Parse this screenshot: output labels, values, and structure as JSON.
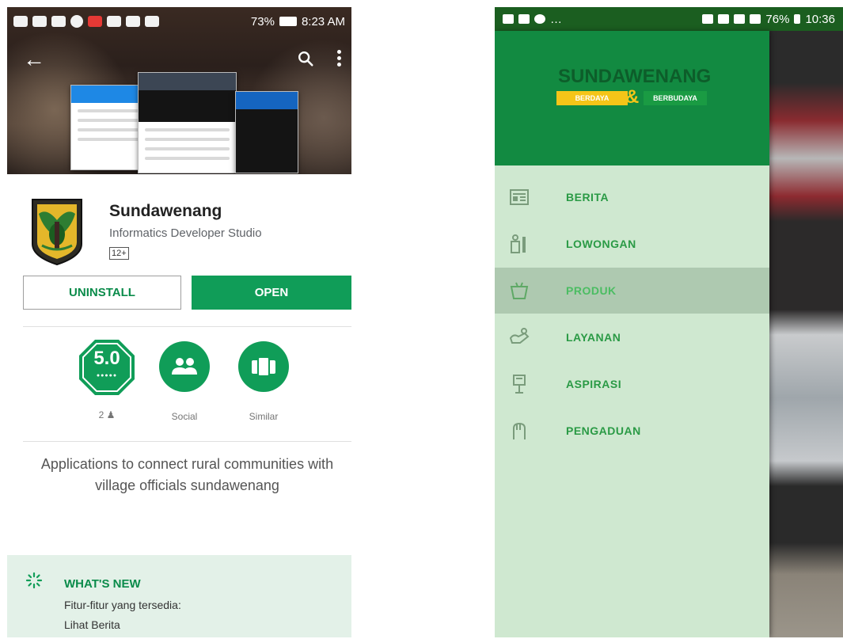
{
  "left": {
    "status_time": "8:23 AM",
    "status_battery": "73%",
    "app": {
      "name": "Sundawenang",
      "developer": "Informatics Developer Studio",
      "content_rating": "12+"
    },
    "buttons": {
      "uninstall": "UNINSTALL",
      "open": "OPEN"
    },
    "badges": {
      "rating_value": "5.0",
      "rating_count": "2",
      "social_label": "Social",
      "similar_label": "Similar"
    },
    "description": "Applications to connect rural communities with village officials sundawenang",
    "whats_new": {
      "title": "WHAT'S NEW",
      "lines": [
        "Fitur-fitur yang tersedia:",
        "Lihat Berita"
      ]
    },
    "colors": {
      "accent": "#109d58",
      "whats_new_bg": "#e3f1e8"
    }
  },
  "right": {
    "status_time": "10:36",
    "status_battery": "76%",
    "drawer": {
      "logo_title": "SUNDAWENANG",
      "tag_left": "BERDAYA",
      "tag_amp": "&",
      "tag_right": "BERBUDAYA",
      "items": [
        {
          "label": "BERITA",
          "icon": "newspaper-icon",
          "active": false
        },
        {
          "label": "LOWONGAN",
          "icon": "job-icon",
          "active": false
        },
        {
          "label": "PRODUK",
          "icon": "basket-icon",
          "active": true
        },
        {
          "label": "LAYANAN",
          "icon": "service-icon",
          "active": false
        },
        {
          "label": "ASPIRASI",
          "icon": "aspiration-icon",
          "active": false
        },
        {
          "label": "PENGADUAN",
          "icon": "complaint-icon",
          "active": false
        }
      ]
    },
    "colors": {
      "header": "#128a41",
      "drawer_bg": "#cfe8d0",
      "label": "#2a9a45"
    }
  }
}
